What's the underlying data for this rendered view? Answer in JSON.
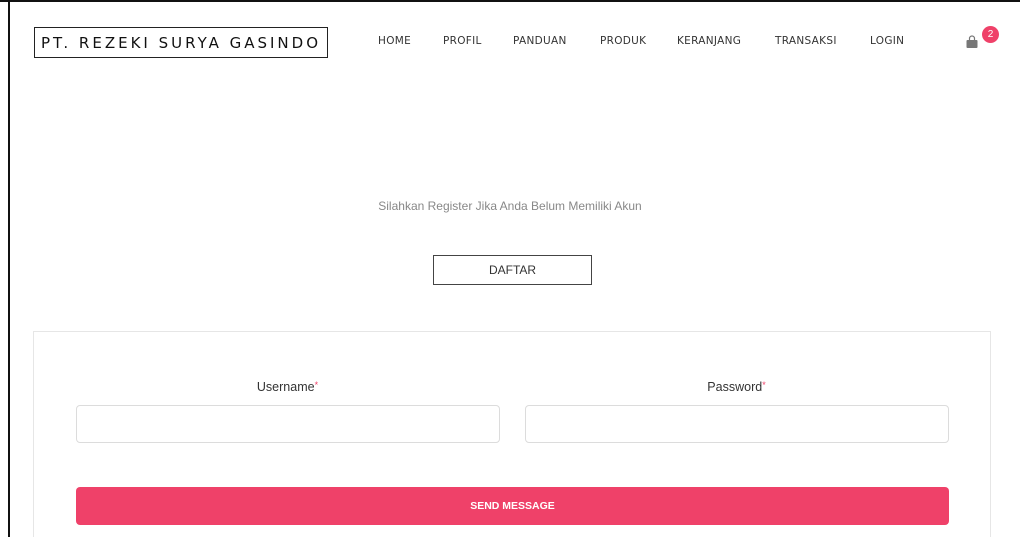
{
  "brand": {
    "name": "PT. REZEKI SURYA GASINDO"
  },
  "nav": {
    "items": [
      {
        "label": "HOME"
      },
      {
        "label": "PROFIL"
      },
      {
        "label": "PANDUAN"
      },
      {
        "label": "PRODUK"
      },
      {
        "label": "KERANJANG"
      },
      {
        "label": "TRANSAKSI"
      },
      {
        "label": "LOGIN"
      }
    ]
  },
  "cart": {
    "icon": "shopping-bag-icon",
    "count": "2",
    "badge_color": "#ef4169"
  },
  "register": {
    "prompt": "Silahkan Register Jika Anda Belum Memiliki Akun",
    "button_label": "DAFTAR"
  },
  "form": {
    "username_label": "Username",
    "password_label": "Password",
    "required_mark": "*",
    "username_value": "",
    "password_value": "",
    "submit_label": "SEND MESSAGE",
    "accent_color": "#ef4169"
  }
}
